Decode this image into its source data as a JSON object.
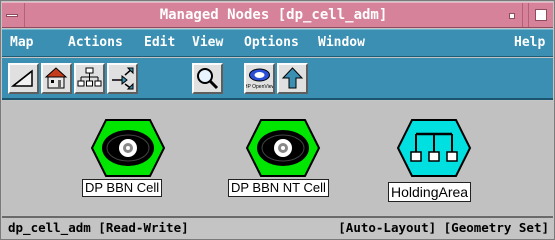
{
  "window": {
    "title": "Managed Nodes [dp_cell_adm]"
  },
  "menubar": {
    "items": [
      "Map",
      "Actions",
      "Edit",
      "View",
      "Options",
      "Window",
      "Help"
    ]
  },
  "toolbar": {
    "buttons": [
      {
        "icon": "up-triangle-icon"
      },
      {
        "icon": "home-icon"
      },
      {
        "icon": "hierarchy-icon"
      },
      {
        "icon": "navigate-arrows-icon"
      },
      {
        "icon": "magnifier-icon"
      },
      {
        "icon": "hp-openview-logo-icon",
        "text": "HP OpenView"
      },
      {
        "icon": "up-arrow-icon"
      }
    ]
  },
  "canvas": {
    "nodes": [
      {
        "label": "DP BBN Cell",
        "icon": "cell-hexagon-icon",
        "color": "#00e600"
      },
      {
        "label": "DP BBN NT Cell",
        "icon": "cell-hexagon-icon",
        "color": "#00e600"
      },
      {
        "label": "HoldingArea",
        "icon": "holding-area-hexagon-icon",
        "color": "#00e0e0"
      }
    ]
  },
  "statusbar": {
    "left": "dp_cell_adm [Read-Write]",
    "right": "[Auto-Layout] [Geometry Set]"
  },
  "colors": {
    "titlebar": "#d6829a",
    "menubar": "#3a8fb2",
    "canvas": "#c1c1c1"
  }
}
